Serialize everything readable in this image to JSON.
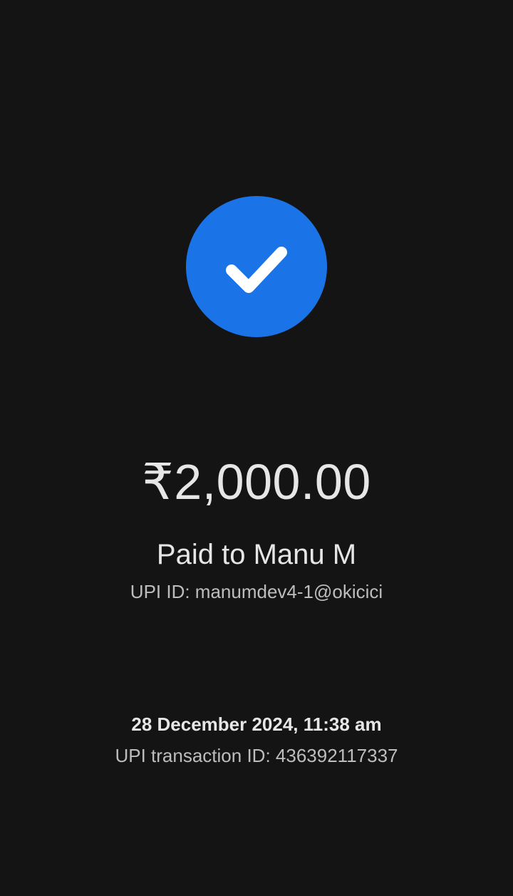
{
  "status": {
    "icon": "checkmark-icon",
    "color": "#1b73e8"
  },
  "payment": {
    "amount": "₹2,000.00",
    "paid_to": "Paid to Manu M",
    "upi_id": "UPI ID: manumdev4-1@okicici"
  },
  "transaction": {
    "datetime": "28 December 2024, 11:38 am",
    "upi_transaction_id": "UPI transaction ID: 436392117337"
  }
}
